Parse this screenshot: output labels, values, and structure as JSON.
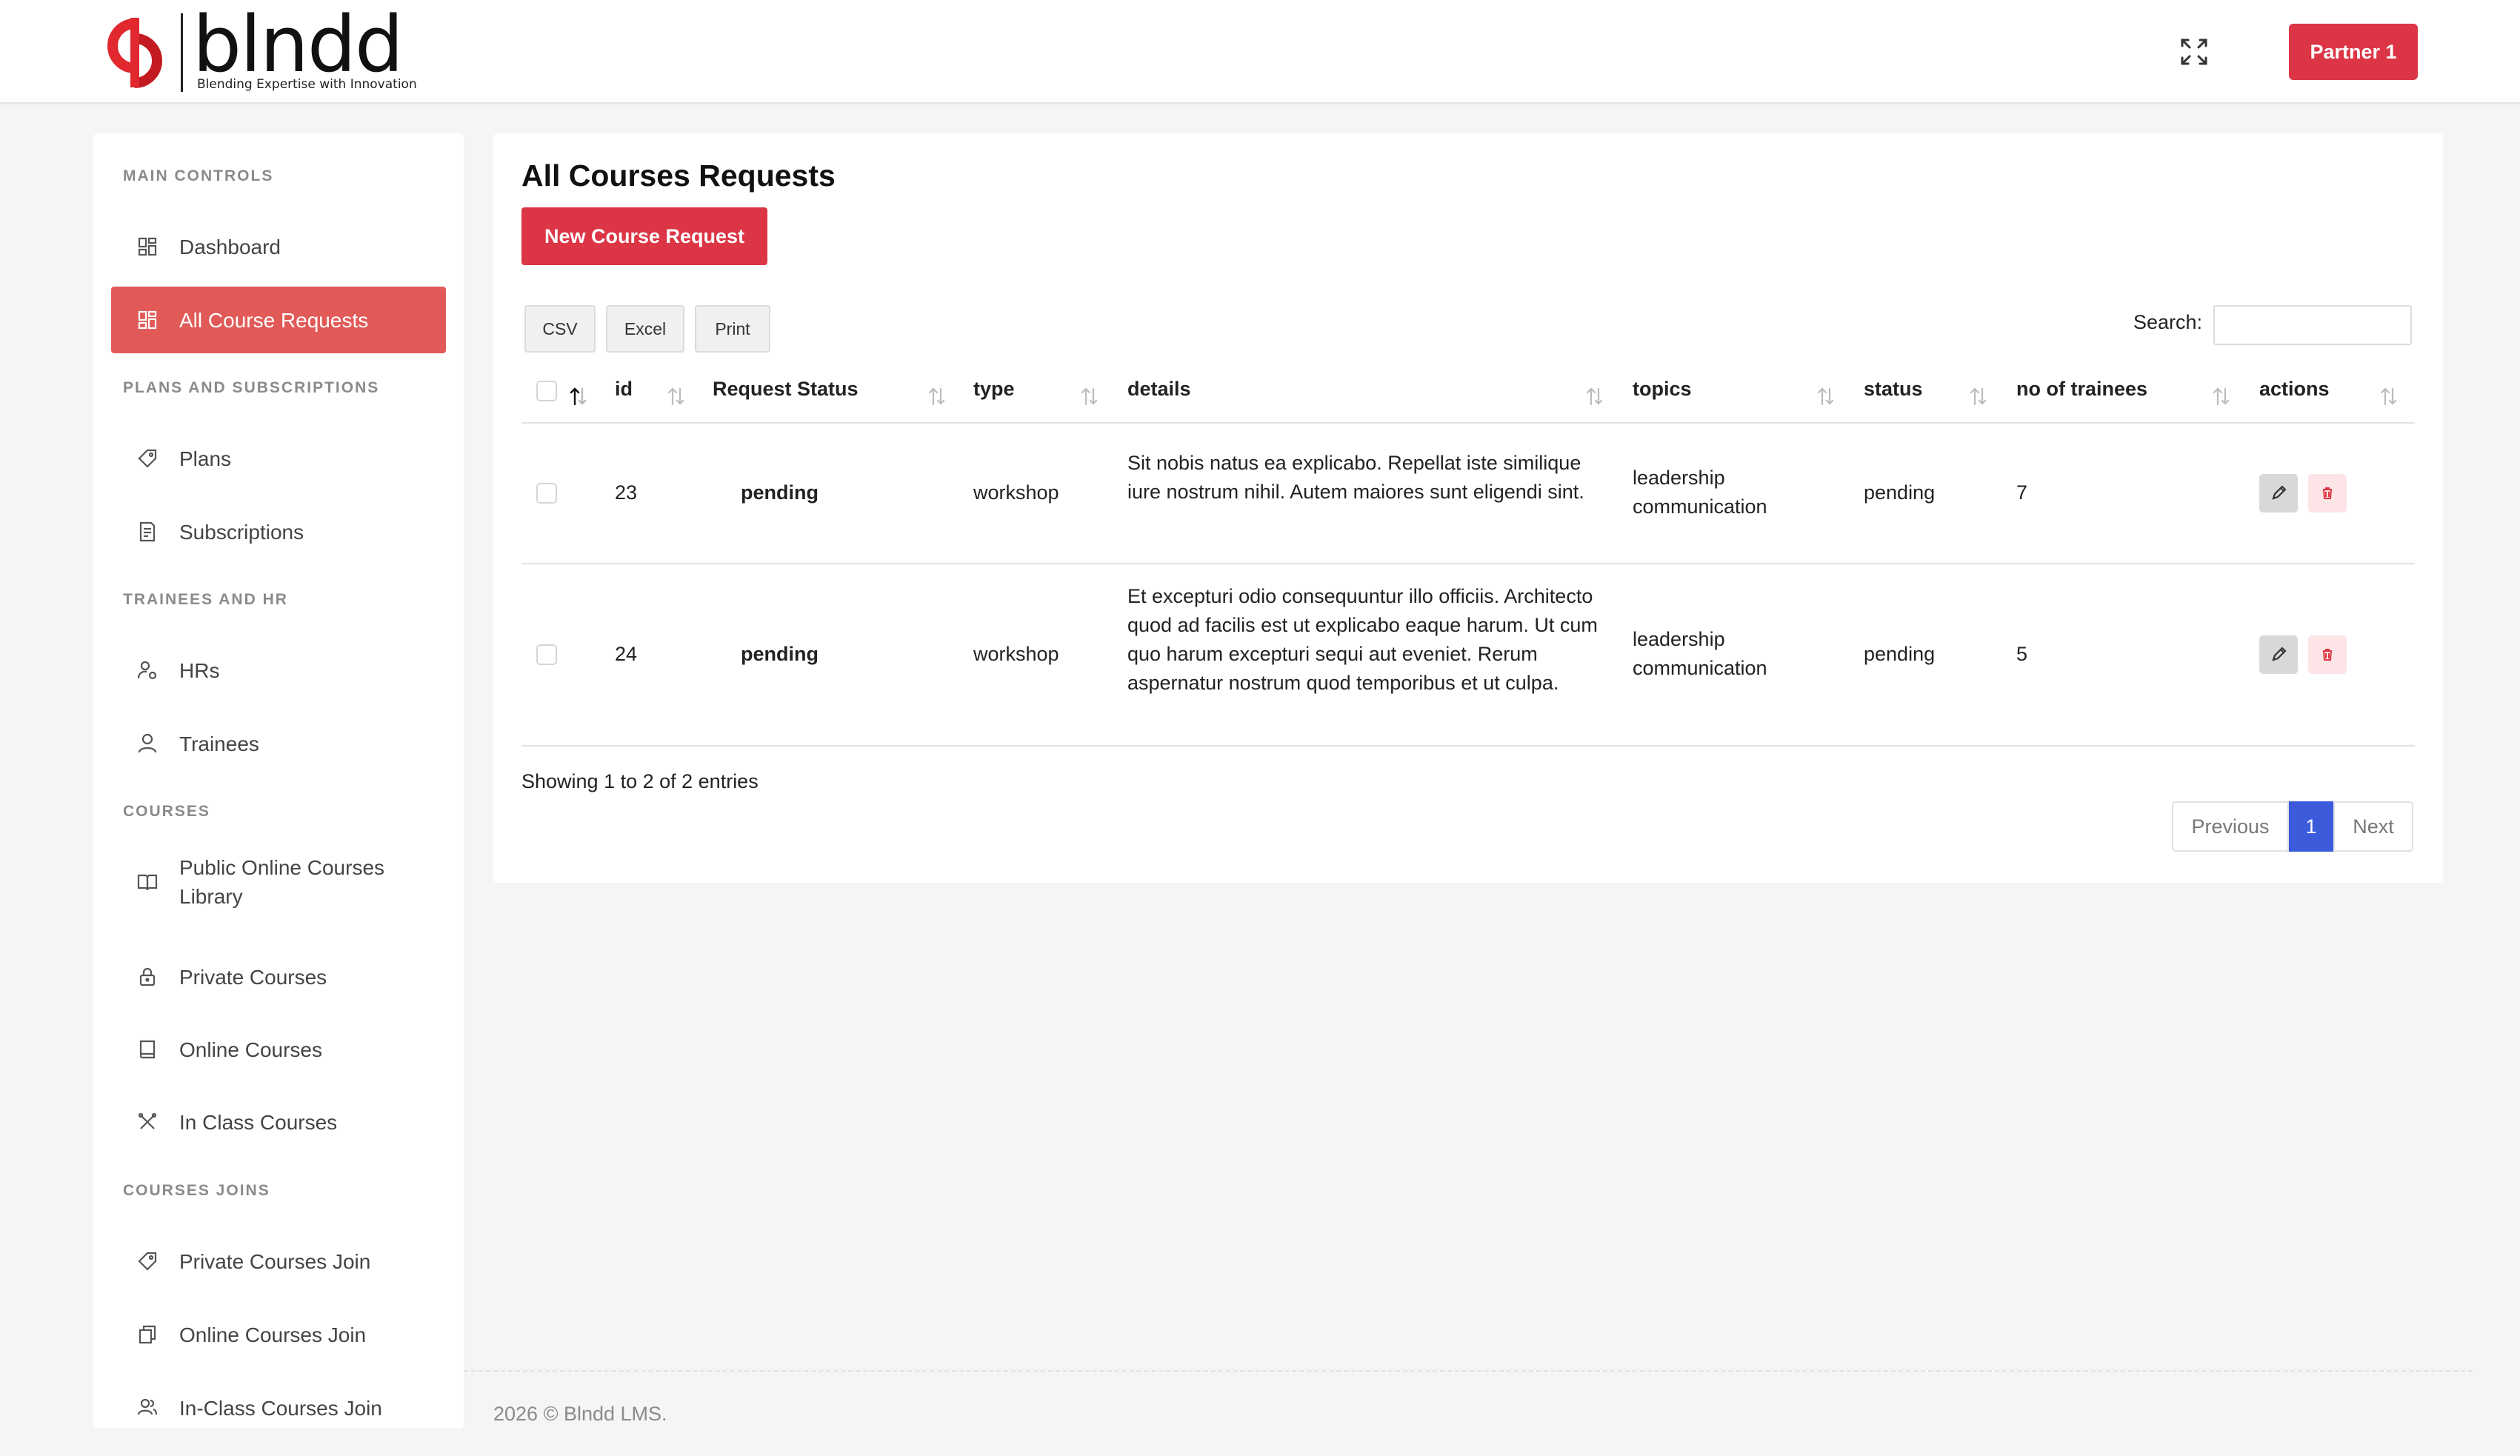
{
  "header": {
    "brand": "blndd",
    "tagline": "Blending Expertise with Innovation",
    "partner_label": "Partner 1"
  },
  "sidebar": {
    "sections": [
      {
        "title": "MAIN CONTROLS",
        "items": [
          {
            "label": "Dashboard",
            "icon": "dashboard-icon"
          },
          {
            "label": "All Course Requests",
            "icon": "dashboard-icon",
            "active": true
          }
        ]
      },
      {
        "title": "PLANS AND SUBSCRIPTIONS",
        "items": [
          {
            "label": "Plans",
            "icon": "tag-icon"
          },
          {
            "label": "Subscriptions",
            "icon": "receipt-icon"
          }
        ]
      },
      {
        "title": "TRAINEES AND HR",
        "items": [
          {
            "label": "HRs",
            "icon": "user-gear-icon"
          },
          {
            "label": "Trainees",
            "icon": "user-icon"
          }
        ]
      },
      {
        "title": "COURSES",
        "items": [
          {
            "label": "Public Online Courses Library",
            "icon": "book-open-icon"
          },
          {
            "label": "Private Courses",
            "icon": "lock-icon"
          },
          {
            "label": "Online Courses",
            "icon": "book-icon"
          },
          {
            "label": "In Class Courses",
            "icon": "tools-icon"
          }
        ]
      },
      {
        "title": "COURSES JOINS",
        "items": [
          {
            "label": "Private Courses Join",
            "icon": "tag-icon"
          },
          {
            "label": "Online Courses Join",
            "icon": "copy-icon"
          },
          {
            "label": "In-Class Courses Join",
            "icon": "users-icon"
          }
        ]
      }
    ]
  },
  "main": {
    "title": "All Courses Requests",
    "new_button": "New Course Request",
    "export": {
      "csv": "CSV",
      "excel": "Excel",
      "print": "Print"
    },
    "search_label": "Search:",
    "search_placeholder": "",
    "columns": [
      "id",
      "Request Status",
      "type",
      "details",
      "topics",
      "status",
      "no of trainees",
      "actions"
    ],
    "rows": [
      {
        "id": "23",
        "request_status": "pending",
        "type": "workshop",
        "details": "Sit nobis natus ea explicabo. Repellat iste similique iure nostrum nihil. Autem maiores sunt eligendi sint.",
        "topics": "leadership communication",
        "status": "pending",
        "trainees": "7"
      },
      {
        "id": "24",
        "request_status": "pending",
        "type": "workshop",
        "details": "Et excepturi odio consequuntur illo officiis. Architecto quod ad facilis est ut explicabo eaque harum. Ut cum quo harum excepturi sequi aut eveniet. Rerum aspernatur nostrum quod temporibus et ut culpa.",
        "topics": "leadership communication",
        "status": "pending",
        "trainees": "5"
      }
    ],
    "info": "Showing 1 to 2 of 2 entries",
    "pager": {
      "previous": "Previous",
      "current": "1",
      "next": "Next"
    }
  },
  "footer": {
    "text": "2026 © Blndd LMS."
  },
  "colors": {
    "brand_red": "#dc3545",
    "active_item": "#e15a58",
    "pager_active": "#3b5bdb"
  }
}
